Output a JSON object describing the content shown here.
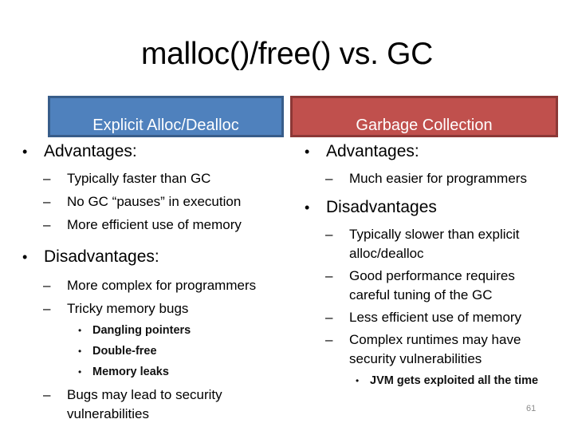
{
  "slide": {
    "title": "malloc()/free() vs. GC",
    "page_number": "61",
    "colors": {
      "left_header": "#4f81bd",
      "right_header": "#c0504d"
    }
  },
  "left": {
    "header": "Explicit Alloc/Dealloc",
    "advantages_label": "Advantages:",
    "advantages": [
      "Typically faster than GC",
      "No GC “pauses” in execution",
      "More efficient use of memory"
    ],
    "disadvantages_label": "Disadvantages:",
    "disadvantages": [
      "More complex for programmers",
      "Tricky memory bugs",
      "Bugs may lead to security vulnerabilities"
    ],
    "memory_bugs": [
      "Dangling pointers",
      "Double-free",
      "Memory leaks"
    ]
  },
  "right": {
    "header": "Garbage Collection",
    "advantages_label": "Advantages:",
    "advantages": [
      "Much easier for programmers"
    ],
    "disadvantages_label": "Disadvantages",
    "disadvantages": [
      "Typically slower than explicit alloc/dealloc",
      "Good performance requires careful tuning of the GC",
      "Less efficient use of memory",
      "Complex runtimes may have security vulnerabilities"
    ],
    "runtime_notes": [
      "JVM gets exploited all the time"
    ]
  },
  "glyphs": {
    "bullet": "•",
    "dash": "–"
  }
}
